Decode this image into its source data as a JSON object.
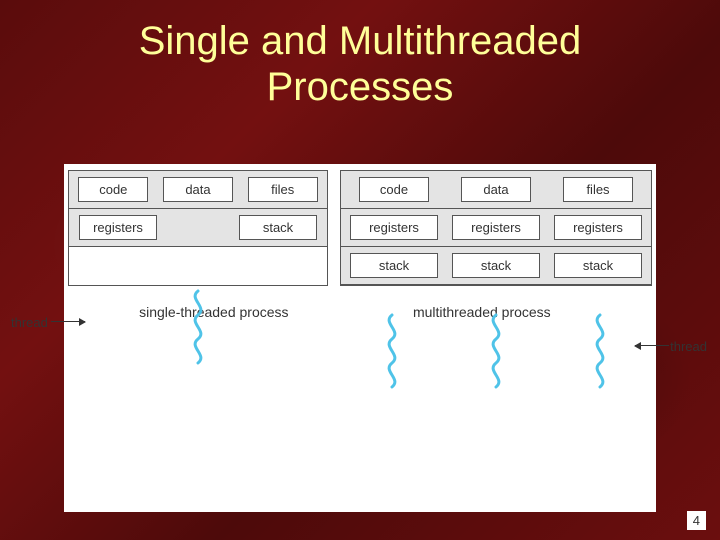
{
  "title_line1": "Single and Multithreaded",
  "title_line2": "Processes",
  "single": {
    "shared": [
      "code",
      "data",
      "files"
    ],
    "registers": "registers",
    "stack": "stack",
    "thread_label": "thread",
    "caption": "single-threaded process"
  },
  "multi": {
    "shared": [
      "code",
      "data",
      "files"
    ],
    "registers": [
      "registers",
      "registers",
      "registers"
    ],
    "stacks": [
      "stack",
      "stack",
      "stack"
    ],
    "thread_label": "thread",
    "caption": "multithreaded process"
  },
  "page_number": "4",
  "colors": {
    "squiggle": "#4fc3e8"
  }
}
